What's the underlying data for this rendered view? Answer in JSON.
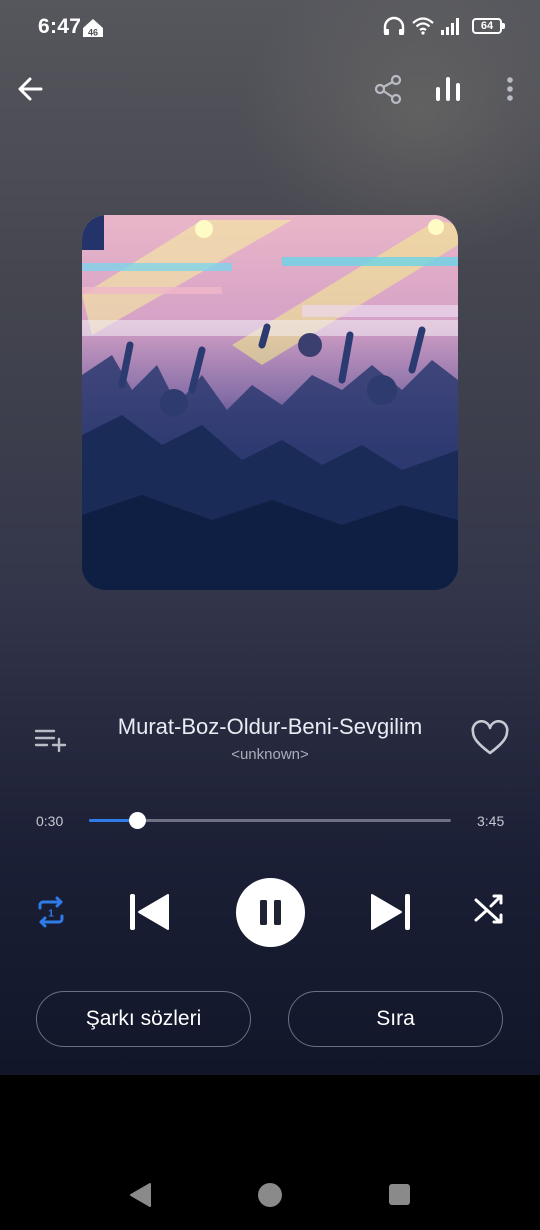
{
  "status_bar": {
    "time": "6:47",
    "network_badge": "46",
    "battery_level": "64",
    "icons": [
      "headphones-icon",
      "wifi-icon",
      "signal-icon",
      "battery-icon"
    ]
  },
  "top_bar": {
    "icons": [
      "arrow-left-icon",
      "share-icon",
      "equalizer-icon",
      "more-vertical-icon"
    ]
  },
  "track": {
    "title": "Murat-Boz-Oldur-Beni-Sevgilim",
    "artist": "<unknown>",
    "elapsed": "0:30",
    "duration": "3:45",
    "progress_fraction": 0.133,
    "liked": false
  },
  "controls": {
    "repeat_mode": "1",
    "state": "playing"
  },
  "buttons": {
    "lyrics": "Şarkı sözleri",
    "queue": "Sıra"
  },
  "colors": {
    "accent": "#2f7be7",
    "text_secondary": "#a9adb8",
    "background_top": "#56575d",
    "background_bottom": "#121629"
  }
}
